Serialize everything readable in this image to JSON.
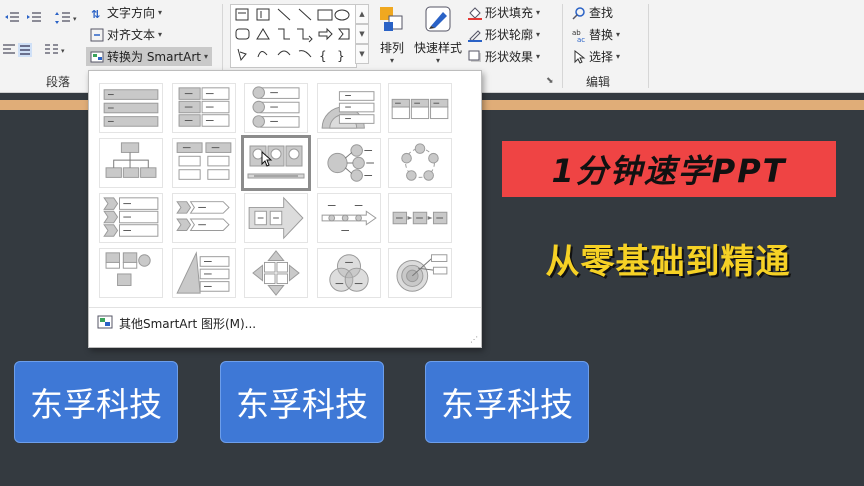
{
  "ribbon": {
    "paragraph": {
      "text_direction": "文字方向",
      "align_text": "对齐文本",
      "convert_smartart": "转换为 SmartArt",
      "group_label": "段落"
    },
    "drawing": {
      "arrange": "排列",
      "quick_styles": "快速样式",
      "shape_fill": "形状填充",
      "shape_outline": "形状轮廓",
      "shape_effects": "形状效果"
    },
    "editing": {
      "find": "查找",
      "replace": "替换",
      "select": "选择",
      "group_label": "编辑"
    }
  },
  "dropdown": {
    "more_smartart": "其他SmartArt 图形(M)...",
    "selected_index": 7
  },
  "slide": {
    "title_red": "1分钟速学PPT",
    "title_yellow": "从零基础到精通",
    "boxes": [
      "东孚科技",
      "东孚科技",
      "东孚科技"
    ]
  },
  "colors": {
    "slide_bg": "#343a40",
    "accent_band": "#e0ad78",
    "title_red_bg": "#ef4444",
    "title_yellow_text": "#f6d125",
    "box_blue": "#3e78d6"
  }
}
